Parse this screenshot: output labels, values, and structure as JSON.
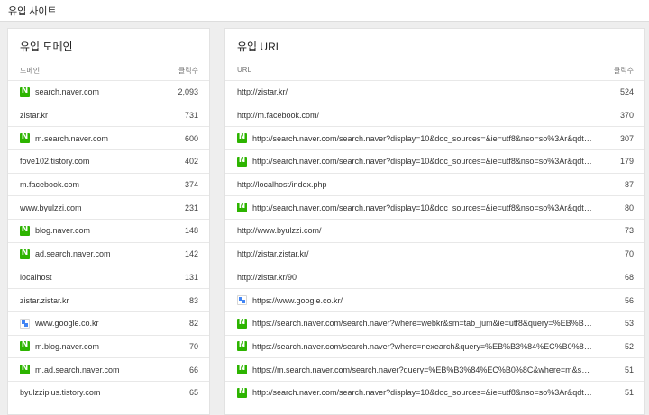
{
  "page": {
    "title": "유입 사이트"
  },
  "domains": {
    "title": "유입 도메인",
    "col_name": "도메인",
    "col_count": "클릭수",
    "rows": [
      {
        "label": "search.naver.com",
        "count": "2,093",
        "icon": "naver-icon"
      },
      {
        "label": "zistar.kr",
        "count": "731",
        "icon": ""
      },
      {
        "label": "m.search.naver.com",
        "count": "600",
        "icon": "naver-icon"
      },
      {
        "label": "fove102.tistory.com",
        "count": "402",
        "icon": ""
      },
      {
        "label": "m.facebook.com",
        "count": "374",
        "icon": ""
      },
      {
        "label": "www.byulzzi.com",
        "count": "231",
        "icon": ""
      },
      {
        "label": "blog.naver.com",
        "count": "148",
        "icon": "naver-icon"
      },
      {
        "label": "ad.search.naver.com",
        "count": "142",
        "icon": "naver-icon"
      },
      {
        "label": "localhost",
        "count": "131",
        "icon": ""
      },
      {
        "label": "zistar.zistar.kr",
        "count": "83",
        "icon": ""
      },
      {
        "label": "www.google.co.kr",
        "count": "82",
        "icon": "google-icon"
      },
      {
        "label": "m.blog.naver.com",
        "count": "70",
        "icon": "naver-icon"
      },
      {
        "label": "m.ad.search.naver.com",
        "count": "66",
        "icon": "naver-icon"
      },
      {
        "label": "byulzziplus.tistory.com",
        "count": "65",
        "icon": ""
      }
    ]
  },
  "urls": {
    "title": "유입 URL",
    "col_name": "URL",
    "col_count": "클릭수",
    "rows": [
      {
        "label": "http://zistar.kr/",
        "count": "524",
        "icon": ""
      },
      {
        "label": "http://m.facebook.com/",
        "count": "370",
        "icon": ""
      },
      {
        "label": "http://search.naver.com/search.naver?display=10&doc_sources=&ie=utf8&nso=so%3Ar&qdt=&qu…",
        "count": "307",
        "icon": "naver-icon"
      },
      {
        "label": "http://search.naver.com/search.naver?display=10&doc_sources=&ie=utf8&nso=so%3Ar&qdt=&qu…",
        "count": "179",
        "icon": "naver-icon"
      },
      {
        "label": "http://localhost/index.php",
        "count": "87",
        "icon": ""
      },
      {
        "label": "http://search.naver.com/search.naver?display=10&doc_sources=&ie=utf8&nso=so%3Ar&qdt=&qu…",
        "count": "80",
        "icon": "naver-icon"
      },
      {
        "label": "http://www.byulzzi.com/",
        "count": "73",
        "icon": ""
      },
      {
        "label": "http://zistar.zistar.kr/",
        "count": "70",
        "icon": ""
      },
      {
        "label": "http://zistar.kr/90",
        "count": "68",
        "icon": ""
      },
      {
        "label": "https://www.google.co.kr/",
        "count": "56",
        "icon": "google-icon"
      },
      {
        "label": "https://search.naver.com/search.naver?where=webkr&sm=tab_jum&ie=utf8&query=%EB%B0%9…",
        "count": "53",
        "icon": "naver-icon"
      },
      {
        "label": "https://search.naver.com/search.naver?where=nexearch&query=%EB%B3%84%EC%B0%8C&sm…",
        "count": "52",
        "icon": "naver-icon"
      },
      {
        "label": "https://m.search.naver.com/search.naver?query=%EB%B3%84%EC%B0%8C&where=m&sm=mo…",
        "count": "51",
        "icon": "naver-icon"
      },
      {
        "label": "http://search.naver.com/search.naver?display=10&doc_sources=&ie=utf8&nso=so%3Ar&qdt=&qu…",
        "count": "51",
        "icon": "naver-icon"
      }
    ]
  }
}
